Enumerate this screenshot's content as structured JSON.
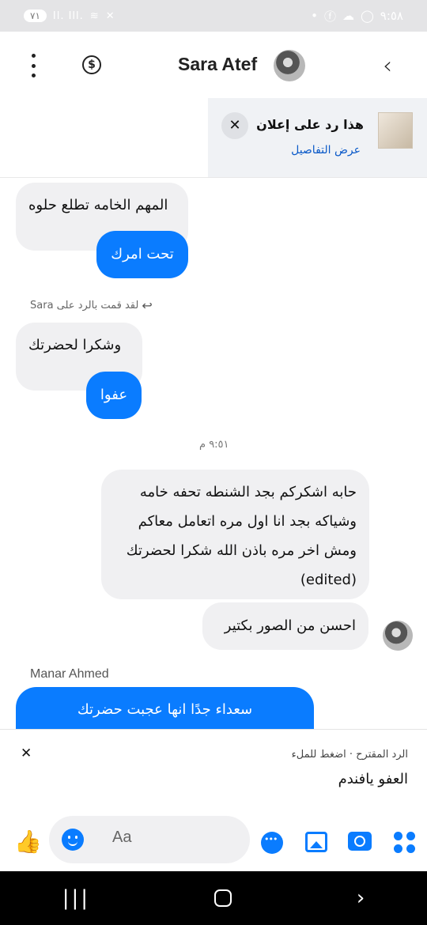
{
  "status_bar": {
    "time": "٩:٥٨",
    "battery": "٧١",
    "signal_text": "Il. Ill."
  },
  "header": {
    "contact_name": "Sara Atef",
    "back_icon": "chevron-left-icon",
    "more_icon": "more-vertical-icon",
    "dollar_icon": "dollar-icon"
  },
  "ad_banner": {
    "title": "هذا رد على إعلان",
    "link": "عرض التفاصيل",
    "close_icon": "close-icon"
  },
  "messages": [
    {
      "text": "المهم الخامه تطلع حلوه"
    },
    {
      "text": "تحت امرك"
    },
    {
      "reply_note": "لقد قمت بالرد على Sara"
    },
    {
      "text": "وشكرا لحضرتك"
    },
    {
      "text": "عفوا"
    },
    {
      "timestamp": "٩:٥١ م"
    },
    {
      "text": "حابه اشكركم بجد الشنطه تحفه خامه وشياكه بجد انا اول مره اتعامل معاكم ومش اخر مره باذن الله شكرا لحضرتك (edited)"
    },
    {
      "text": "احسن من الصور بكتير"
    },
    {
      "sender": "Manar Ahmed"
    },
    {
      "text": "سعداء جدًا انها عجبت حضرتك"
    }
  ],
  "suggested_reply": {
    "hint": "الرد المقترح · اضغط للملء",
    "text": "العفو يافندم"
  },
  "composer": {
    "placeholder": "Aa"
  },
  "colors": {
    "accent": "#0a7cff",
    "bubble_gray": "#f0f0f2"
  }
}
